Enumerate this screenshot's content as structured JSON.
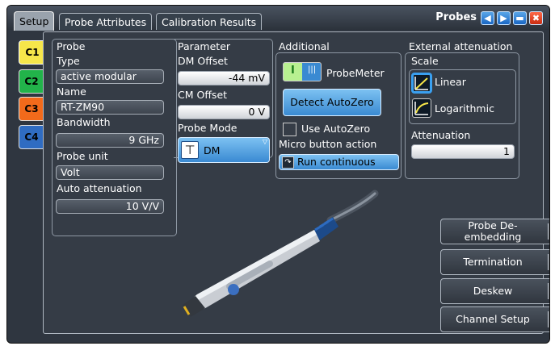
{
  "window": {
    "title": "Probes"
  },
  "tabs": [
    "Setup",
    "Probe Attributes",
    "Calibration Results"
  ],
  "channels": [
    "C1",
    "C2",
    "C3",
    "C4"
  ],
  "probe": {
    "heading": "Probe",
    "type_label": "Type",
    "type_value": "active modular",
    "name_label": "Name",
    "name_value": "RT-ZM90",
    "bandwidth_label": "Bandwidth",
    "bandwidth_value": "9 GHz",
    "unit_label": "Probe unit",
    "unit_value": "Volt",
    "autoatt_label": "Auto attenuation",
    "autoatt_value": "10 V/V"
  },
  "parameter": {
    "heading": "Parameter",
    "dm_label": "DM Offset",
    "dm_value": "-44 mV",
    "cm_label": "CM Offset",
    "cm_value": "0 V",
    "mode_label": "Probe Mode",
    "mode_value": "DM"
  },
  "additional": {
    "heading": "Additional",
    "probemeter_label": "ProbeMeter",
    "autozero_button": "Detect AutoZero",
    "use_autozero_label": "Use AutoZero",
    "micro_label": "Micro button action",
    "micro_value": "Run continuous"
  },
  "external": {
    "heading": "External attenuation",
    "scale_label": "Scale",
    "linear_label": "Linear",
    "log_label": "Logarithmic",
    "att_label": "Attenuation",
    "att_value": "1"
  },
  "nav": [
    "Probe De-\nembedding",
    "Termination",
    "Deskew",
    "Channel Setup"
  ],
  "colors": {
    "c1": "#f6e64a",
    "c2": "#22b34a",
    "c3": "#f26a1b",
    "c4": "#2f6cc2",
    "accent": "#3a8ad2"
  }
}
